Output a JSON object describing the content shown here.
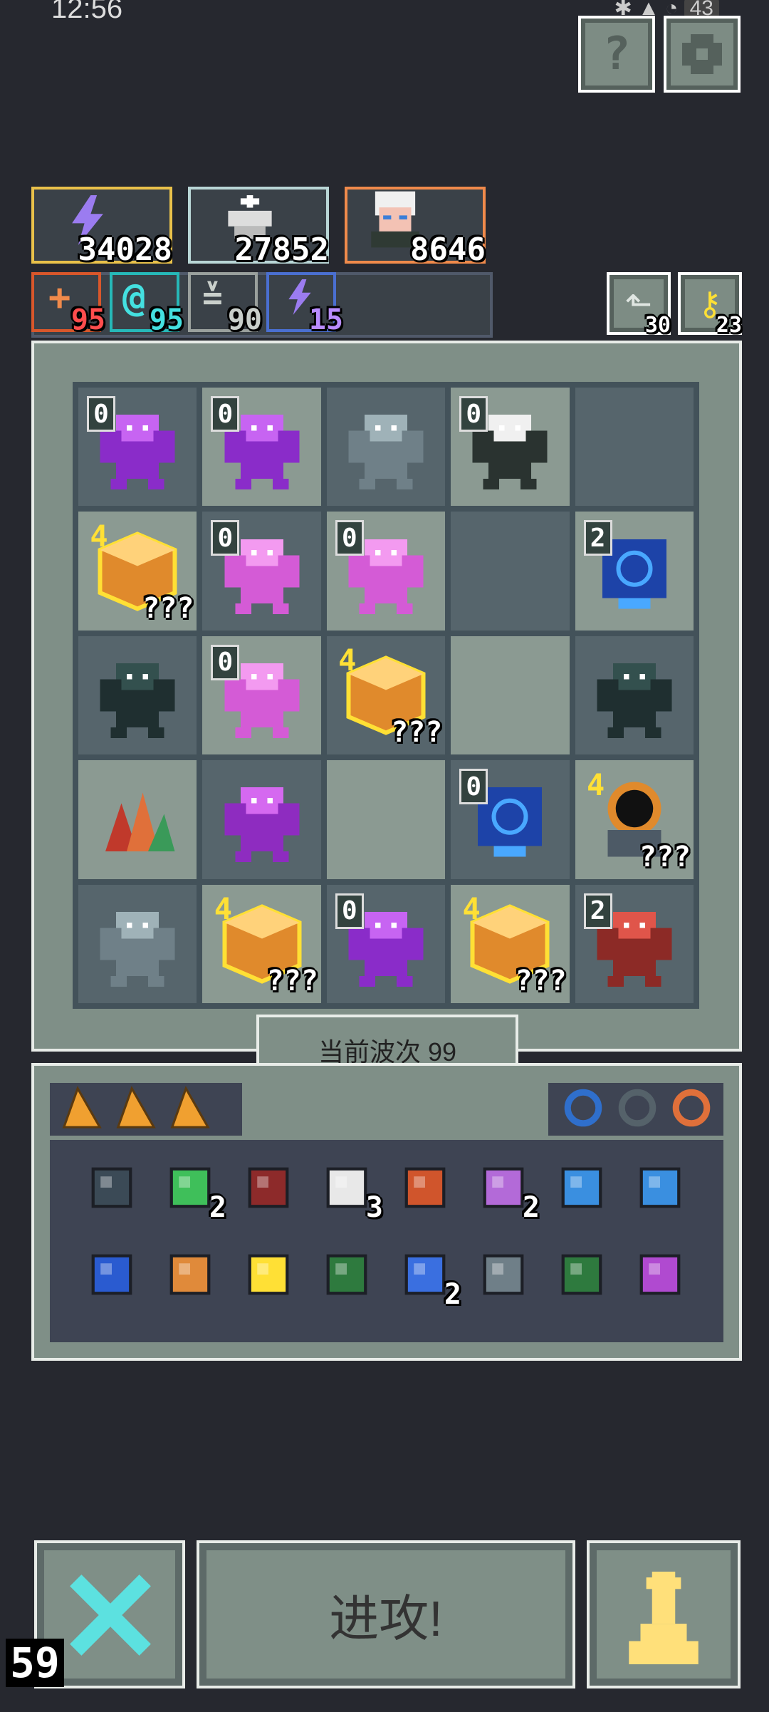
{
  "status": {
    "time": "12:56",
    "battery": "43"
  },
  "top_buttons": {
    "help": "?",
    "settings": "gear"
  },
  "resources": [
    {
      "value": "34028",
      "color": "#e9c14a",
      "icon": "lightning-icon"
    },
    {
      "value": "27852",
      "color": "#b9d6d6",
      "icon": "chess-king-icon"
    },
    {
      "value": "8646",
      "color": "#f08a4b",
      "icon": "hero-portrait-icon"
    }
  ],
  "stats": [
    {
      "value": "95",
      "color": "#d8572b",
      "text_color": "#ff4d4d",
      "icon": "plus-icon"
    },
    {
      "value": "95",
      "color": "#26b8b8",
      "text_color": "#44e0e0",
      "icon": "spiral-icon"
    },
    {
      "value": "90",
      "color": "#9aa09d",
      "text_color": "#c9cfcb",
      "icon": "wing-icon"
    },
    {
      "value": "15",
      "color": "#4a6fd0",
      "text_color": "#b98cff",
      "icon": "bolt-icon"
    }
  ],
  "side_counters": [
    {
      "value": "30",
      "icon": "return-arrow-icon"
    },
    {
      "value": "23",
      "icon": "key-icon"
    }
  ],
  "board": {
    "cells": [
      {
        "m": "purple-dragon",
        "lvl": "0"
      },
      {
        "m": "purple-dragon",
        "lvl": "0"
      },
      {
        "m": "grey-golem",
        "lvl": ""
      },
      {
        "m": "white-hair-witch",
        "lvl": "0"
      },
      {
        "m": "",
        "lvl": ""
      },
      {
        "m": "orange-cube",
        "lvl": "4",
        "qq": "???"
      },
      {
        "m": "pink-gargoyle",
        "lvl": "0"
      },
      {
        "m": "pink-gargoyle",
        "lvl": "0"
      },
      {
        "m": "",
        "lvl": ""
      },
      {
        "m": "blue-rune",
        "lvl": "2"
      },
      {
        "m": "dark-cthulhu",
        "lvl": ""
      },
      {
        "m": "pink-gargoyle",
        "lvl": "0"
      },
      {
        "m": "orange-cube",
        "lvl": "4",
        "qq": "???"
      },
      {
        "m": "",
        "lvl": ""
      },
      {
        "m": "dark-cthulhu",
        "lvl": ""
      },
      {
        "m": "red-crystal",
        "lvl": ""
      },
      {
        "m": "purple-demon",
        "lvl": ""
      },
      {
        "m": "",
        "lvl": ""
      },
      {
        "m": "blue-rune",
        "lvl": "0"
      },
      {
        "m": "black-hole-knight",
        "lvl": "4",
        "qq": "???"
      },
      {
        "m": "grey-golem",
        "lvl": ""
      },
      {
        "m": "orange-cube",
        "lvl": "4",
        "qq": "???"
      },
      {
        "m": "purple-dragon",
        "lvl": "0"
      },
      {
        "m": "orange-cube",
        "lvl": "4",
        "qq": "???"
      },
      {
        "m": "red-dragon",
        "lvl": "2"
      }
    ]
  },
  "wave_label": "当前波次 99",
  "inventory": {
    "shards": [
      "orange-shard-icon",
      "orange-shard-icon",
      "orange-shard-icon"
    ],
    "rings": [
      "blue-ring-icon",
      "helmet-icon",
      "orange-ring-icon"
    ],
    "row1": [
      {
        "icon": "shield-icon",
        "count": ""
      },
      {
        "icon": "green-gem-icon",
        "count": "2"
      },
      {
        "icon": "axe-icon",
        "count": ""
      },
      {
        "icon": "wings-icon",
        "count": "3"
      },
      {
        "icon": "arrow-icon",
        "count": ""
      },
      {
        "icon": "potion-jar-icon",
        "count": "2"
      },
      {
        "icon": "blue-snake-icon",
        "count": ""
      },
      {
        "icon": "water-drop-icon",
        "count": ""
      }
    ],
    "row2": [
      {
        "icon": "drop-frame-icon",
        "count": ""
      },
      {
        "icon": "mushroom-icon",
        "count": ""
      },
      {
        "icon": "chalice-icon",
        "count": ""
      },
      {
        "icon": "green-map-icon",
        "count": ""
      },
      {
        "icon": "hourglass-icon",
        "count": "2"
      },
      {
        "icon": "joystick-icon",
        "count": ""
      },
      {
        "icon": "red-map-icon",
        "count": ""
      },
      {
        "icon": "purple-key-icon",
        "count": ""
      }
    ]
  },
  "actions": {
    "cancel": "cancel-x-icon",
    "attack_label": "进攻!",
    "pawn": "pawn-icon"
  },
  "fps_counter": "59"
}
